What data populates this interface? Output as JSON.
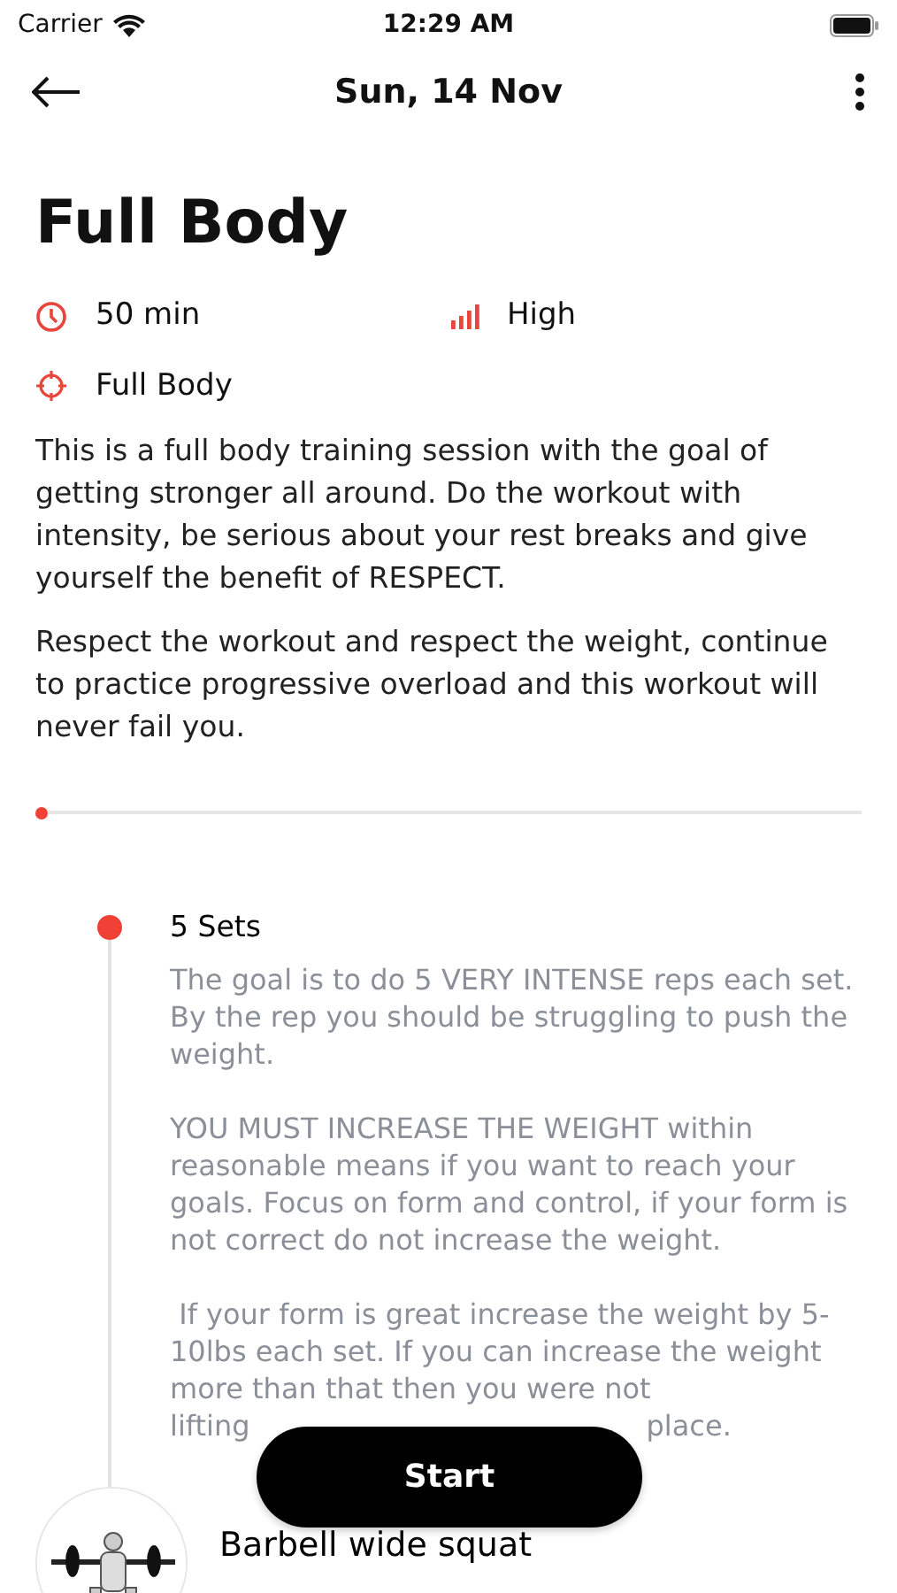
{
  "status_bar": {
    "carrier": "Carrier",
    "time": "12:29 AM"
  },
  "nav": {
    "title": "Sun, 14 Nov"
  },
  "workout": {
    "title": "Full Body",
    "duration": "50 min",
    "intensity": "High",
    "focus": "Full Body"
  },
  "description": [
    "This is a full body training session with the goal of getting stronger all around. Do the workout with intensity, be serious about your rest breaks and give yourself the benefit of RESPECT.",
    "Respect the workout and respect the weight, continue to practice progressive overload and this workout will never fail you."
  ],
  "progress": {
    "level": 0
  },
  "timeline": [
    {
      "kind": "note",
      "title": "5 Sets",
      "paragraphs": [
        "The goal is to do 5 VERY INTENSE reps each set. By the rep you should be struggling to push the weight.",
        "YOU MUST INCREASE THE WEIGHT within reasonable means if you want to reach your goals. Focus on form and control, if your form is not correct do not increase the weight.",
        " If your form is great increase the weight by 5-10lbs each set. If you can increase the weight more than that then you were not"
      ],
      "last_line": [
        "lifting",
        "place."
      ]
    },
    {
      "kind": "exercise",
      "title": "Barbell wide squat"
    }
  ],
  "start_button": "Start"
}
